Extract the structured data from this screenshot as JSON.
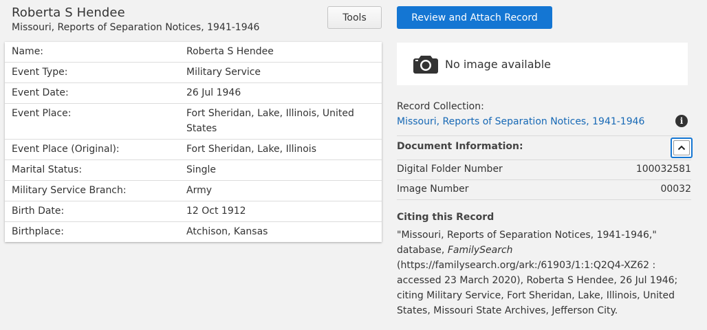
{
  "header": {
    "title": "Roberta S Hendee",
    "subtitle": "Missouri, Reports of Separation Notices, 1941-1946"
  },
  "buttons": {
    "tools": "Tools",
    "attach": "Review and Attach Record"
  },
  "details": [
    {
      "label": "Name:",
      "value": "Roberta S Hendee"
    },
    {
      "label": "Event Type:",
      "value": "Military Service"
    },
    {
      "label": "Event Date:",
      "value": "26 Jul 1946"
    },
    {
      "label": "Event Place:",
      "value": "Fort Sheridan, Lake, Illinois, United States"
    },
    {
      "label": "Event Place (Original):",
      "value": "Fort Sheridan, Lake, Illinois"
    },
    {
      "label": "Marital Status:",
      "value": "Single"
    },
    {
      "label": "Military Service Branch:",
      "value": "Army"
    },
    {
      "label": "Birth Date:",
      "value": "12 Oct 1912"
    },
    {
      "label": "Birthplace:",
      "value": "Atchison, Kansas"
    }
  ],
  "image_panel": {
    "icon": "camera-icon",
    "text": "No image available"
  },
  "record_collection": {
    "label": "Record Collection:",
    "link": "Missouri, Reports of Separation Notices, 1941-1946",
    "info_icon": "i"
  },
  "document_info": {
    "heading": "Document Information:",
    "rows": [
      {
        "label": "Digital Folder Number",
        "value": "100032581"
      },
      {
        "label": "Image Number",
        "value": "00032"
      }
    ]
  },
  "citation": {
    "heading": "Citing this Record",
    "part1": "\"Missouri, Reports of Separation Notices, 1941-1946,\" database, ",
    "site": "FamilySearch",
    "part2": " (https://familysearch.org/ark:/61903/1:1:Q2Q4-XZ62 : accessed 23 March 2020), Roberta S Hendee, 26 Jul 1946; citing Military Service, Fort Sheridan, Lake, Illinois, United States, Missouri State Archives, Jefferson City."
  },
  "colors": {
    "accent": "#1476d3",
    "link": "#1668b5",
    "background": "#f2f2f2"
  }
}
